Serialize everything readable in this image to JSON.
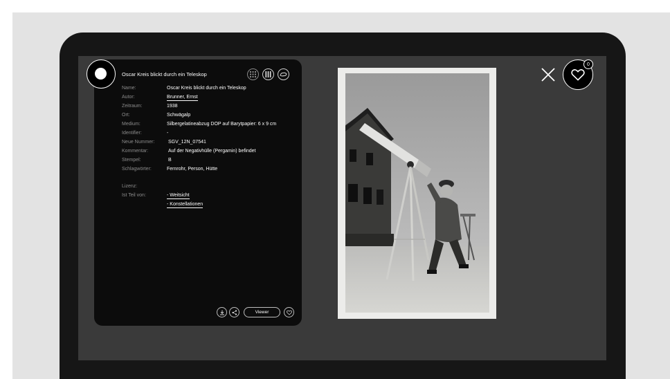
{
  "record": {
    "title": "Oscar Kreis blickt durch ein Teleskop",
    "fields": [
      {
        "label": "Name:",
        "value": "Oscar Kreis blickt durch ein Teleskop"
      },
      {
        "label": "Autor:",
        "value": "Brunner, Ernst"
      },
      {
        "label": "Zeitraum:",
        "value": "1938"
      },
      {
        "label": "Ort:",
        "value": "Schwägalp"
      },
      {
        "label": "Medium:",
        "value": "Silbergelatineabzug DOP auf Barytpapier: 6 x 9 cm"
      },
      {
        "label": "Identifier:",
        "value": "-"
      },
      {
        "label": "Neue Nummer:",
        "value": "SGV_12N_07541"
      },
      {
        "label": "Kommentar:",
        "value": "Auf der Negativhülle (Pergamin) befindet"
      },
      {
        "label": "Stempel:",
        "value": "B"
      },
      {
        "label": "Schlagwörter:",
        "value": "Fernrohr, Person, Hütte"
      }
    ],
    "license_label": "Lizenz:",
    "part_of_label": "Ist Teil von:",
    "part_of": [
      "- Weitsicht",
      "- Konstellationen"
    ]
  },
  "actions": {
    "viewer_label": "Viewer",
    "favorites_count": "0"
  },
  "icons": {
    "logo": "circle-logo-icon",
    "grid": "grid-view-icon",
    "columns": "columns-view-icon",
    "map": "map-view-icon",
    "download": "download-icon",
    "share": "share-icon",
    "like": "heart-icon",
    "close": "close-icon",
    "favorites": "heart-icon"
  }
}
